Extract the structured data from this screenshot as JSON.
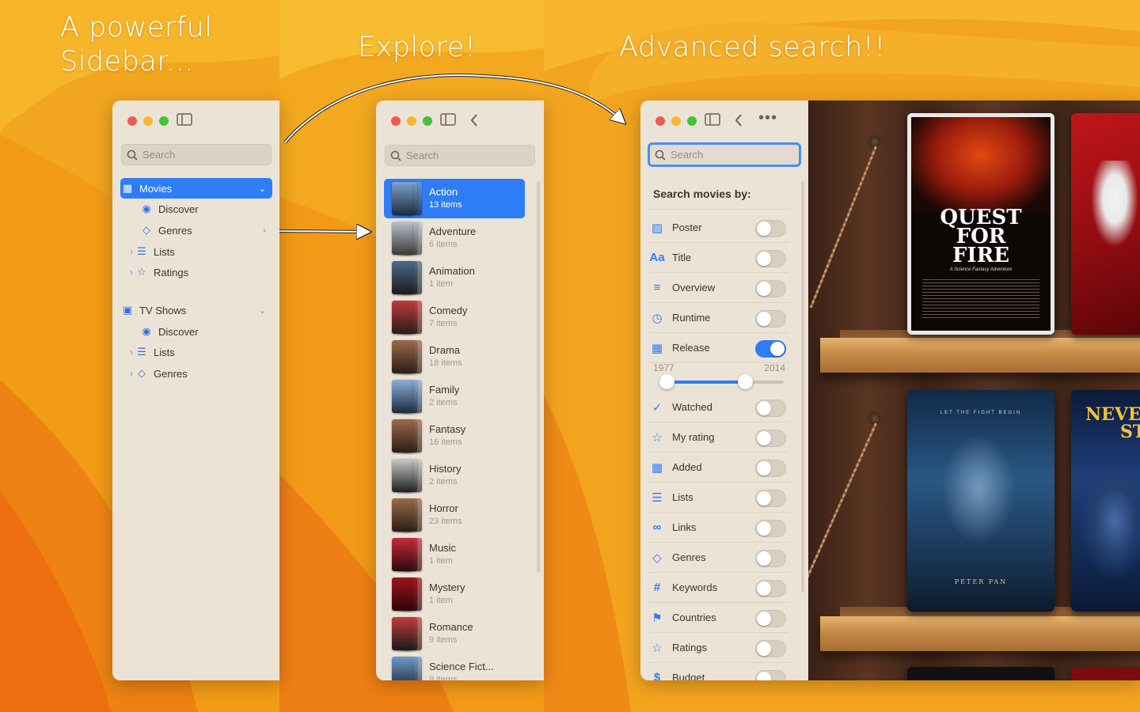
{
  "captions": {
    "sidebar": "A powerful Sidebar...",
    "explore": "Explore!",
    "search": "Advanced search!!"
  },
  "window1": {
    "search_placeholder": "Search",
    "sections": [
      {
        "label": "Movies",
        "icon": "film-icon",
        "children": [
          {
            "label": "Discover",
            "icon": "eye-icon"
          },
          {
            "label": "Genres",
            "icon": "tag-icon"
          },
          {
            "label": "Lists",
            "icon": "list-icon"
          },
          {
            "label": "Ratings",
            "icon": "star-icon"
          }
        ]
      },
      {
        "label": "TV Shows",
        "icon": "tv-icon",
        "children": [
          {
            "label": "Discover",
            "icon": "eye-icon"
          },
          {
            "label": "Lists",
            "icon": "list-icon"
          },
          {
            "label": "Genres",
            "icon": "tag-icon"
          }
        ]
      }
    ]
  },
  "window2": {
    "search_placeholder": "Search",
    "genres": [
      {
        "name": "Action",
        "count": "13 items"
      },
      {
        "name": "Adventure",
        "count": "6 items"
      },
      {
        "name": "Animation",
        "count": "1 item"
      },
      {
        "name": "Comedy",
        "count": "7 items"
      },
      {
        "name": "Drama",
        "count": "18 items"
      },
      {
        "name": "Family",
        "count": "2 items"
      },
      {
        "name": "Fantasy",
        "count": "16 items"
      },
      {
        "name": "History",
        "count": "2 items"
      },
      {
        "name": "Horror",
        "count": "23 items"
      },
      {
        "name": "Music",
        "count": "1 item"
      },
      {
        "name": "Mystery",
        "count": "1 item"
      },
      {
        "name": "Romance",
        "count": "9 items"
      },
      {
        "name": "Science Fict...",
        "count": "9 items"
      }
    ]
  },
  "window3": {
    "search_placeholder": "Search",
    "heading": "Search movies by:",
    "options": [
      {
        "label": "Poster",
        "icon": "image-icon",
        "on": false
      },
      {
        "label": "Title",
        "icon": "text-icon",
        "on": false
      },
      {
        "label": "Overview",
        "icon": "paragraph-icon",
        "on": false
      },
      {
        "label": "Runtime",
        "icon": "clock-icon",
        "on": false
      },
      {
        "label": "Release",
        "icon": "calendar-icon",
        "on": true
      },
      {
        "label": "Watched",
        "icon": "checkmark-icon",
        "on": false
      },
      {
        "label": "My rating",
        "icon": "star-icon",
        "on": false
      },
      {
        "label": "Added",
        "icon": "calendar-icon",
        "on": false
      },
      {
        "label": "Lists",
        "icon": "list-icon",
        "on": false
      },
      {
        "label": "Links",
        "icon": "link-icon",
        "on": false
      },
      {
        "label": "Genres",
        "icon": "tag-icon",
        "on": false
      },
      {
        "label": "Keywords",
        "icon": "hash-icon",
        "on": false
      },
      {
        "label": "Countries",
        "icon": "flag-icon",
        "on": false
      },
      {
        "label": "Ratings",
        "icon": "star-icon",
        "on": false
      },
      {
        "label": "Budget",
        "icon": "dollar-icon",
        "on": false
      }
    ],
    "release_range": {
      "min": "1977",
      "max": "2014",
      "low_fraction": 0.0,
      "high_fraction": 0.72
    },
    "posters": {
      "quest": {
        "title_line1": "QUEST",
        "title_line2": "FOR",
        "title_line3": "FIRE",
        "tagline": "A Science Fantasy Adventure"
      },
      "peter": {
        "tagline": "LET THE FIGHT BEGIN",
        "title": "PETER PAN"
      },
      "never": {
        "title": "NEVER",
        "sub": "ST"
      }
    }
  },
  "colors": {
    "accent": "#2f7df6",
    "window": "#ece3d7"
  }
}
